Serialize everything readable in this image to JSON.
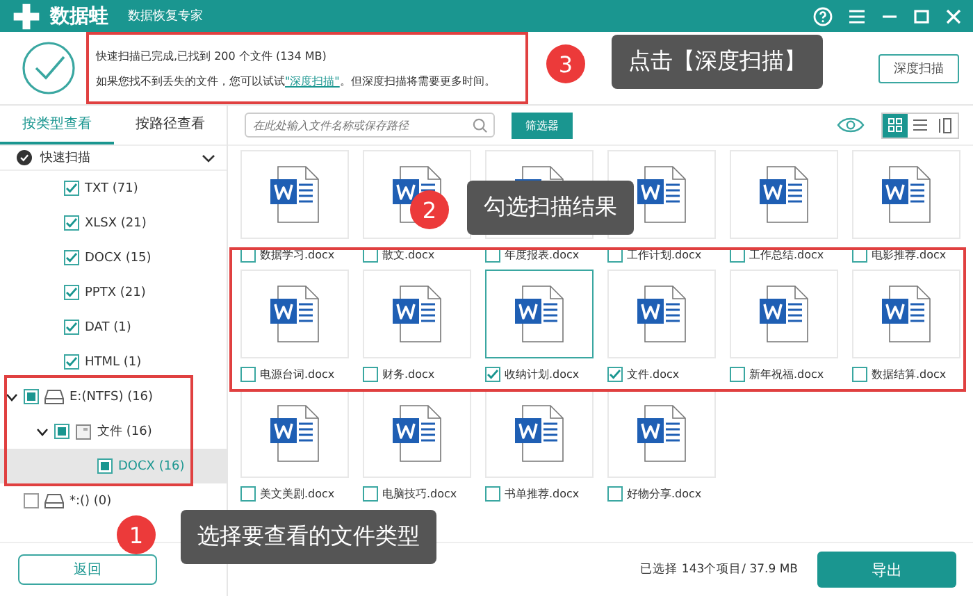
{
  "app": {
    "name": "数据蛙",
    "subtitle": "数据恢复专家"
  },
  "message": {
    "line1": "快速扫描已完成,已找到 200 个文件 (134 MB)",
    "line2_before": "如果您找不到丢失的文件，您可以试试",
    "line2_link": "\"深度扫描\"",
    "line2_after": "。但深度扫描将需要更多时间。"
  },
  "deep_scan_button": "深度扫描",
  "tabs": [
    {
      "label": "按类型查看",
      "selected": true
    },
    {
      "label": "按路径查看",
      "selected": false
    }
  ],
  "search": {
    "placeholder": "在此处输入文件名称或保存路径"
  },
  "filter_button": "筛选器",
  "views": [
    {
      "kind": "grid",
      "selected": true
    },
    {
      "kind": "list",
      "selected": false
    },
    {
      "kind": "panel",
      "selected": false
    }
  ],
  "tree": {
    "label": "快速扫描",
    "expanded": true,
    "children": [
      {
        "label": "TXT (71)",
        "kind": "type",
        "checked": true,
        "partial": false,
        "selected": false
      },
      {
        "label": "XLSX (21)",
        "kind": "type",
        "checked": true,
        "partial": false,
        "selected": false
      },
      {
        "label": "DOCX (15)",
        "kind": "type",
        "checked": true,
        "partial": false,
        "selected": false
      },
      {
        "label": "PPTX (21)",
        "kind": "type",
        "checked": true,
        "partial": false,
        "selected": false
      },
      {
        "label": "DAT (1)",
        "kind": "type",
        "checked": true,
        "partial": false,
        "selected": false
      },
      {
        "label": "HTML (1)",
        "kind": "type",
        "checked": true,
        "partial": false,
        "selected": false
      },
      {
        "label": "E:(NTFS) (16)",
        "kind": "drive",
        "checked": true,
        "partial": true,
        "expanded": true,
        "selected": false,
        "children": [
          {
            "label": "文件 (16)",
            "kind": "folder",
            "checked": true,
            "partial": true,
            "expanded": true,
            "selected": false,
            "children": [
              {
                "label": "DOCX (16)",
                "kind": "type",
                "checked": true,
                "partial": true,
                "selected": true
              }
            ]
          }
        ]
      },
      {
        "label": "*:() (0)",
        "kind": "drive",
        "checked": false,
        "partial": false,
        "selected": false
      }
    ]
  },
  "files": [
    {
      "name": "数据学习.docx",
      "checked": false,
      "selected": false
    },
    {
      "name": "散文.docx",
      "checked": false,
      "selected": false
    },
    {
      "name": "年度报表.docx",
      "checked": false,
      "selected": false
    },
    {
      "name": "工作计划.docx",
      "checked": false,
      "selected": false
    },
    {
      "name": "工作总结.docx",
      "checked": false,
      "selected": false
    },
    {
      "name": "电影推荐.docx",
      "checked": false,
      "selected": false
    },
    {
      "name": "电源台词.docx",
      "checked": false,
      "selected": false
    },
    {
      "name": "财务.docx",
      "checked": false,
      "selected": false
    },
    {
      "name": "收纳计划.docx",
      "checked": true,
      "selected": true
    },
    {
      "name": "文件.docx",
      "checked": true,
      "selected": false
    },
    {
      "name": "新年祝福.docx",
      "checked": false,
      "selected": false
    },
    {
      "name": "数据结算.docx",
      "checked": false,
      "selected": false
    },
    {
      "name": "美文美剧.docx",
      "checked": false,
      "selected": false
    },
    {
      "name": "电脑技巧.docx",
      "checked": false,
      "selected": false
    },
    {
      "name": "书单推荐.docx",
      "checked": false,
      "selected": false
    },
    {
      "name": "好物分享.docx",
      "checked": false,
      "selected": false
    }
  ],
  "back_button": "返回",
  "status": "已选择 143个项目/ 37.9 MB",
  "export_button": "导出",
  "annotations": [
    {
      "number": "3",
      "text": "点击【深度扫描】"
    },
    {
      "number": "2",
      "text": "勾选扫描结果"
    },
    {
      "number": "1",
      "text": "选择要查看的文件类型"
    }
  ]
}
